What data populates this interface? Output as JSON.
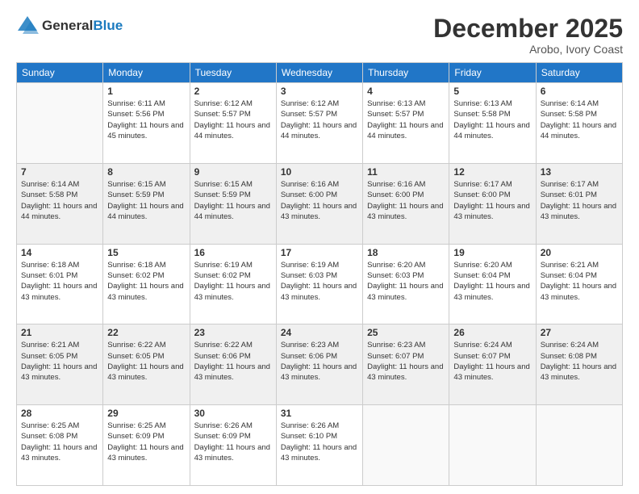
{
  "header": {
    "logo_general": "General",
    "logo_blue": "Blue",
    "title": "December 2025",
    "location": "Arobo, Ivory Coast"
  },
  "weekdays": [
    "Sunday",
    "Monday",
    "Tuesday",
    "Wednesday",
    "Thursday",
    "Friday",
    "Saturday"
  ],
  "weeks": [
    {
      "shaded": false,
      "days": [
        {
          "num": "",
          "sunrise": "",
          "sunset": "",
          "daylight": ""
        },
        {
          "num": "1",
          "sunrise": "6:11 AM",
          "sunset": "5:56 PM",
          "daylight": "11 hours and 45 minutes."
        },
        {
          "num": "2",
          "sunrise": "6:12 AM",
          "sunset": "5:57 PM",
          "daylight": "11 hours and 44 minutes."
        },
        {
          "num": "3",
          "sunrise": "6:12 AM",
          "sunset": "5:57 PM",
          "daylight": "11 hours and 44 minutes."
        },
        {
          "num": "4",
          "sunrise": "6:13 AM",
          "sunset": "5:57 PM",
          "daylight": "11 hours and 44 minutes."
        },
        {
          "num": "5",
          "sunrise": "6:13 AM",
          "sunset": "5:58 PM",
          "daylight": "11 hours and 44 minutes."
        },
        {
          "num": "6",
          "sunrise": "6:14 AM",
          "sunset": "5:58 PM",
          "daylight": "11 hours and 44 minutes."
        }
      ]
    },
    {
      "shaded": true,
      "days": [
        {
          "num": "7",
          "sunrise": "6:14 AM",
          "sunset": "5:58 PM",
          "daylight": "11 hours and 44 minutes."
        },
        {
          "num": "8",
          "sunrise": "6:15 AM",
          "sunset": "5:59 PM",
          "daylight": "11 hours and 44 minutes."
        },
        {
          "num": "9",
          "sunrise": "6:15 AM",
          "sunset": "5:59 PM",
          "daylight": "11 hours and 44 minutes."
        },
        {
          "num": "10",
          "sunrise": "6:16 AM",
          "sunset": "6:00 PM",
          "daylight": "11 hours and 43 minutes."
        },
        {
          "num": "11",
          "sunrise": "6:16 AM",
          "sunset": "6:00 PM",
          "daylight": "11 hours and 43 minutes."
        },
        {
          "num": "12",
          "sunrise": "6:17 AM",
          "sunset": "6:00 PM",
          "daylight": "11 hours and 43 minutes."
        },
        {
          "num": "13",
          "sunrise": "6:17 AM",
          "sunset": "6:01 PM",
          "daylight": "11 hours and 43 minutes."
        }
      ]
    },
    {
      "shaded": false,
      "days": [
        {
          "num": "14",
          "sunrise": "6:18 AM",
          "sunset": "6:01 PM",
          "daylight": "11 hours and 43 minutes."
        },
        {
          "num": "15",
          "sunrise": "6:18 AM",
          "sunset": "6:02 PM",
          "daylight": "11 hours and 43 minutes."
        },
        {
          "num": "16",
          "sunrise": "6:19 AM",
          "sunset": "6:02 PM",
          "daylight": "11 hours and 43 minutes."
        },
        {
          "num": "17",
          "sunrise": "6:19 AM",
          "sunset": "6:03 PM",
          "daylight": "11 hours and 43 minutes."
        },
        {
          "num": "18",
          "sunrise": "6:20 AM",
          "sunset": "6:03 PM",
          "daylight": "11 hours and 43 minutes."
        },
        {
          "num": "19",
          "sunrise": "6:20 AM",
          "sunset": "6:04 PM",
          "daylight": "11 hours and 43 minutes."
        },
        {
          "num": "20",
          "sunrise": "6:21 AM",
          "sunset": "6:04 PM",
          "daylight": "11 hours and 43 minutes."
        }
      ]
    },
    {
      "shaded": true,
      "days": [
        {
          "num": "21",
          "sunrise": "6:21 AM",
          "sunset": "6:05 PM",
          "daylight": "11 hours and 43 minutes."
        },
        {
          "num": "22",
          "sunrise": "6:22 AM",
          "sunset": "6:05 PM",
          "daylight": "11 hours and 43 minutes."
        },
        {
          "num": "23",
          "sunrise": "6:22 AM",
          "sunset": "6:06 PM",
          "daylight": "11 hours and 43 minutes."
        },
        {
          "num": "24",
          "sunrise": "6:23 AM",
          "sunset": "6:06 PM",
          "daylight": "11 hours and 43 minutes."
        },
        {
          "num": "25",
          "sunrise": "6:23 AM",
          "sunset": "6:07 PM",
          "daylight": "11 hours and 43 minutes."
        },
        {
          "num": "26",
          "sunrise": "6:24 AM",
          "sunset": "6:07 PM",
          "daylight": "11 hours and 43 minutes."
        },
        {
          "num": "27",
          "sunrise": "6:24 AM",
          "sunset": "6:08 PM",
          "daylight": "11 hours and 43 minutes."
        }
      ]
    },
    {
      "shaded": false,
      "days": [
        {
          "num": "28",
          "sunrise": "6:25 AM",
          "sunset": "6:08 PM",
          "daylight": "11 hours and 43 minutes."
        },
        {
          "num": "29",
          "sunrise": "6:25 AM",
          "sunset": "6:09 PM",
          "daylight": "11 hours and 43 minutes."
        },
        {
          "num": "30",
          "sunrise": "6:26 AM",
          "sunset": "6:09 PM",
          "daylight": "11 hours and 43 minutes."
        },
        {
          "num": "31",
          "sunrise": "6:26 AM",
          "sunset": "6:10 PM",
          "daylight": "11 hours and 43 minutes."
        },
        {
          "num": "",
          "sunrise": "",
          "sunset": "",
          "daylight": ""
        },
        {
          "num": "",
          "sunrise": "",
          "sunset": "",
          "daylight": ""
        },
        {
          "num": "",
          "sunrise": "",
          "sunset": "",
          "daylight": ""
        }
      ]
    }
  ],
  "labels": {
    "sunrise": "Sunrise:",
    "sunset": "Sunset:",
    "daylight": "Daylight:"
  }
}
